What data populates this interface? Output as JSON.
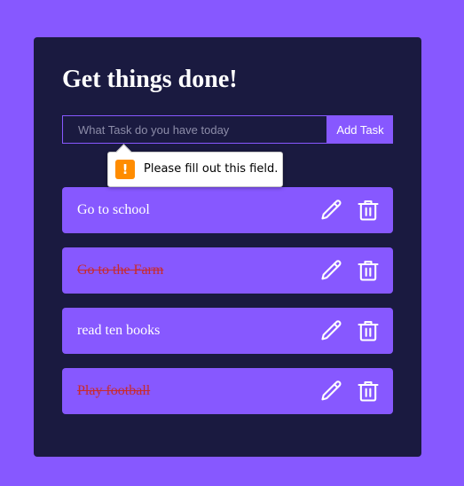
{
  "app": {
    "title": "Get things done!"
  },
  "form": {
    "placeholder": "What Task do you have today",
    "value": "",
    "add_label": "Add Task"
  },
  "validation": {
    "message": "Please fill out this field.",
    "icon": "warning-icon"
  },
  "todos": [
    {
      "text": "Go to school",
      "completed": false
    },
    {
      "text": "Go to the Farm",
      "completed": true
    },
    {
      "text": "read ten books",
      "completed": false
    },
    {
      "text": "Play football",
      "completed": true
    }
  ],
  "icons": {
    "edit": "pencil-icon",
    "delete": "trash-icon"
  },
  "colors": {
    "page_background": "#8758ff",
    "card_background": "#1a1a40",
    "accent": "#8758ff",
    "completed_text": "#c92a2a",
    "warning": "#ff8c00"
  }
}
